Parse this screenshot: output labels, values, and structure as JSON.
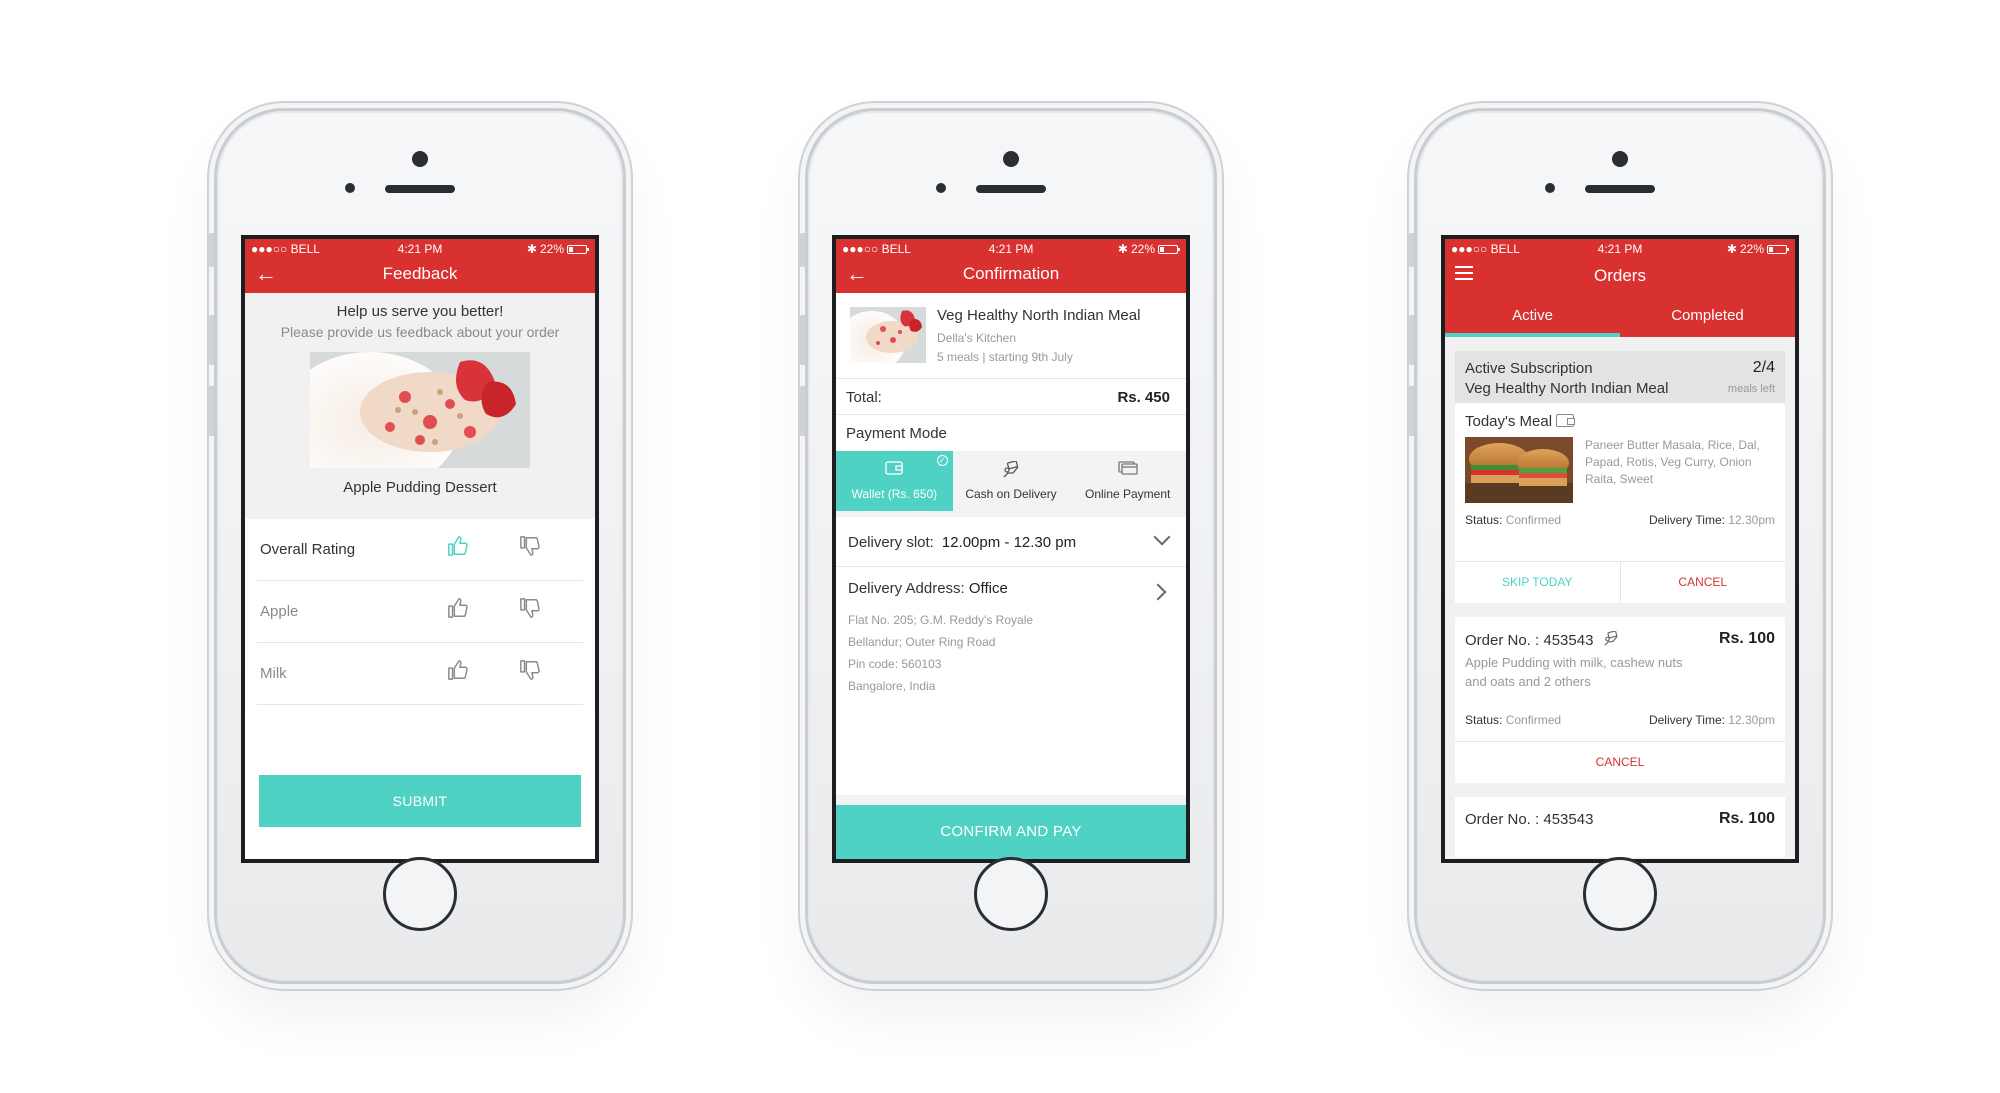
{
  "status_bar": {
    "carrier": "●●●○○ BELL",
    "time": "4:21 PM",
    "battery": "22%"
  },
  "feedback": {
    "title": "Feedback",
    "heading": "Help us serve you better!",
    "subheading": "Please provide us feedback about your order",
    "dish_name": "Apple Pudding Dessert",
    "ratings": [
      {
        "label": "Overall Rating",
        "selected": "up"
      },
      {
        "label": "Apple",
        "selected": ""
      },
      {
        "label": "Milk",
        "selected": ""
      }
    ],
    "submit_label": "SUBMIT"
  },
  "confirmation": {
    "title": "Confirmation",
    "item_name": "Veg Healthy North Indian Meal",
    "kitchen": "Della's Kitchen",
    "plan": "5 meals | starting 9th July",
    "total_label": "Total:",
    "total_value": "Rs. 450",
    "payment_mode_label": "Payment Mode",
    "payment_options": [
      {
        "label": "Wallet (Rs. 650)",
        "icon": "wallet-icon"
      },
      {
        "label": "Cash on Delivery",
        "icon": "cash-icon"
      },
      {
        "label": "Online Payment",
        "icon": "card-icon"
      }
    ],
    "selected_payment": "Wallet (Rs. 650)",
    "slot_label": "Delivery slot:",
    "slot_value": "12.00pm - 12.30 pm",
    "address_label": "Delivery Address:",
    "address_type": "Office",
    "address_lines": [
      "Flat No. 205; G.M. Reddy's Royale",
      "Bellandur; Outer Ring Road",
      "Pin code: 560103",
      "Bangalore, India"
    ],
    "confirm_label": "CONFIRM AND PAY"
  },
  "orders": {
    "title": "Orders",
    "tabs": [
      "Active",
      "Completed"
    ],
    "selected_tab": "Active",
    "subscription": {
      "label": "Active Subscription",
      "meal": "Veg Healthy North Indian Meal",
      "progress": "2/4",
      "progress_caption": "meals left",
      "todays_meal_label": "Today's Meal",
      "todays_meal_desc": "Paneer Butter Masala, Rice, Dal, Papad, Rotis, Veg Curry, Onion Raita, Sweet",
      "status_label": "Status:",
      "status_value": "Confirmed",
      "delivery_label": "Delivery Time:",
      "delivery_value": "12.30pm",
      "skip_label": "SKIP TODAY",
      "cancel_label": "CANCEL"
    },
    "order": {
      "number": "Order No. : 453543",
      "price": "Rs. 100",
      "desc": "Apple Pudding with milk, cashew nuts and oats and 2 others",
      "status_label": "Status:",
      "status_value": "Confirmed",
      "delivery_label": "Delivery Time:",
      "delivery_value": "12.30pm",
      "cancel_label": "CANCEL"
    },
    "order2": {
      "number": "Order No. : 453543",
      "price": "Rs. 100"
    }
  },
  "colors": {
    "brand_red": "#d93030",
    "accent_teal": "#4fd2c3"
  }
}
